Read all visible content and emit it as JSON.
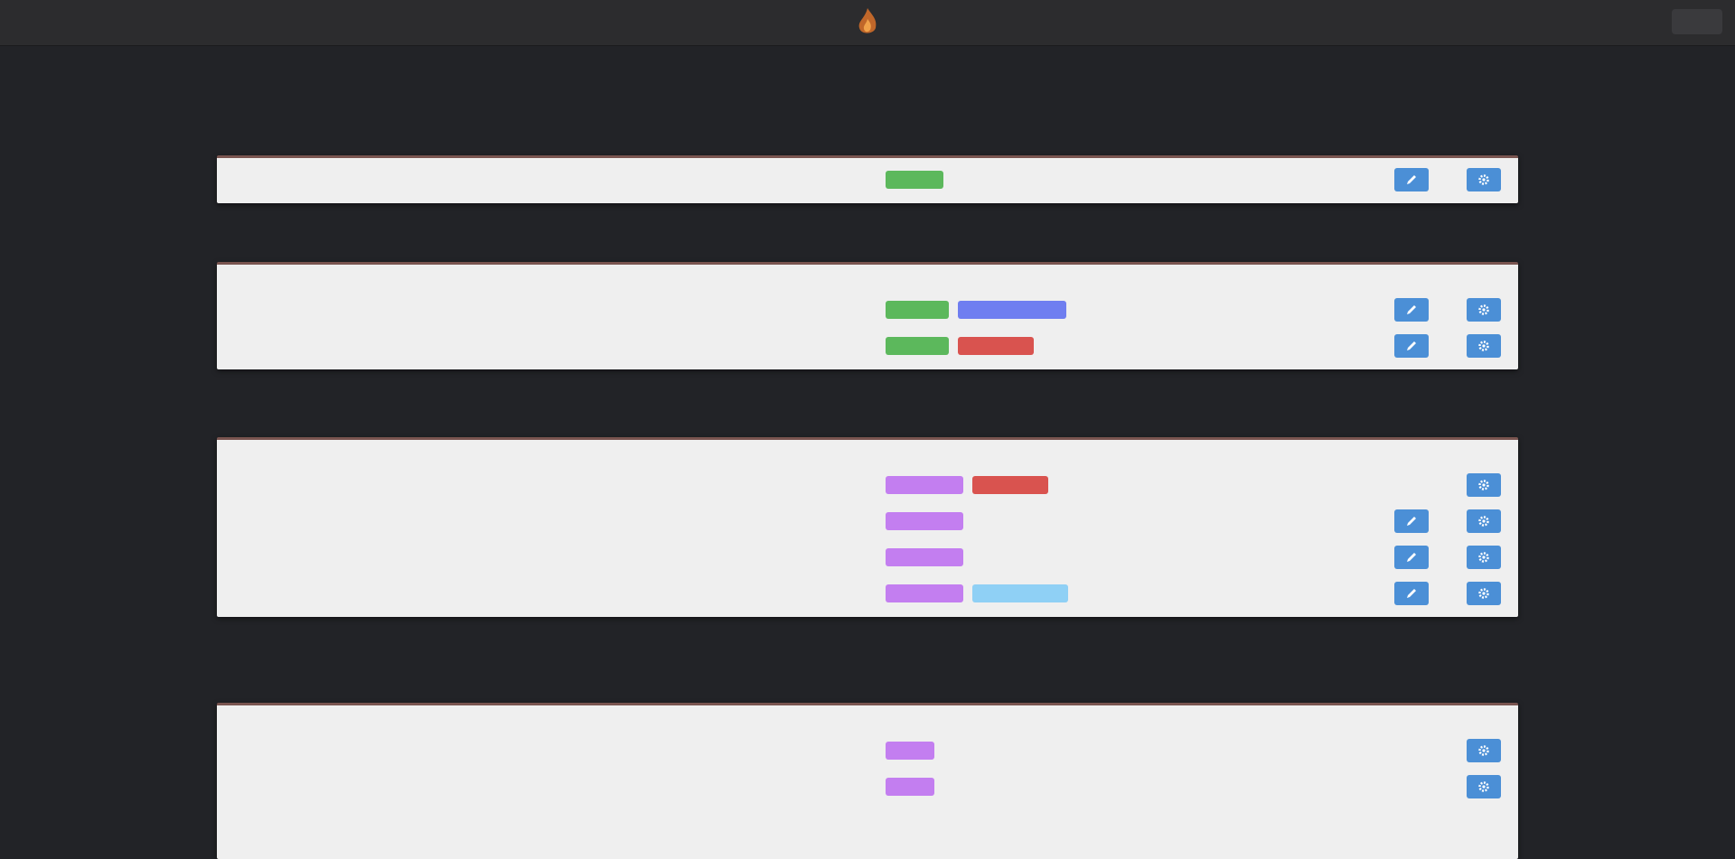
{
  "colors": {
    "background": "#222327",
    "card": "#efefef",
    "accent_border": "#7a5550",
    "tag_green": "#5cb85c",
    "tag_blue": "#6f7ef0",
    "tag_red": "#d9534f",
    "tag_purple": "#c37ef0",
    "tag_lightblue": "#8fd0f5",
    "button_blue": "#4b8fd6"
  },
  "icons": {
    "logo": "flame-logo-icon",
    "edit": "pencil-icon",
    "settings": "gear-icon"
  }
}
